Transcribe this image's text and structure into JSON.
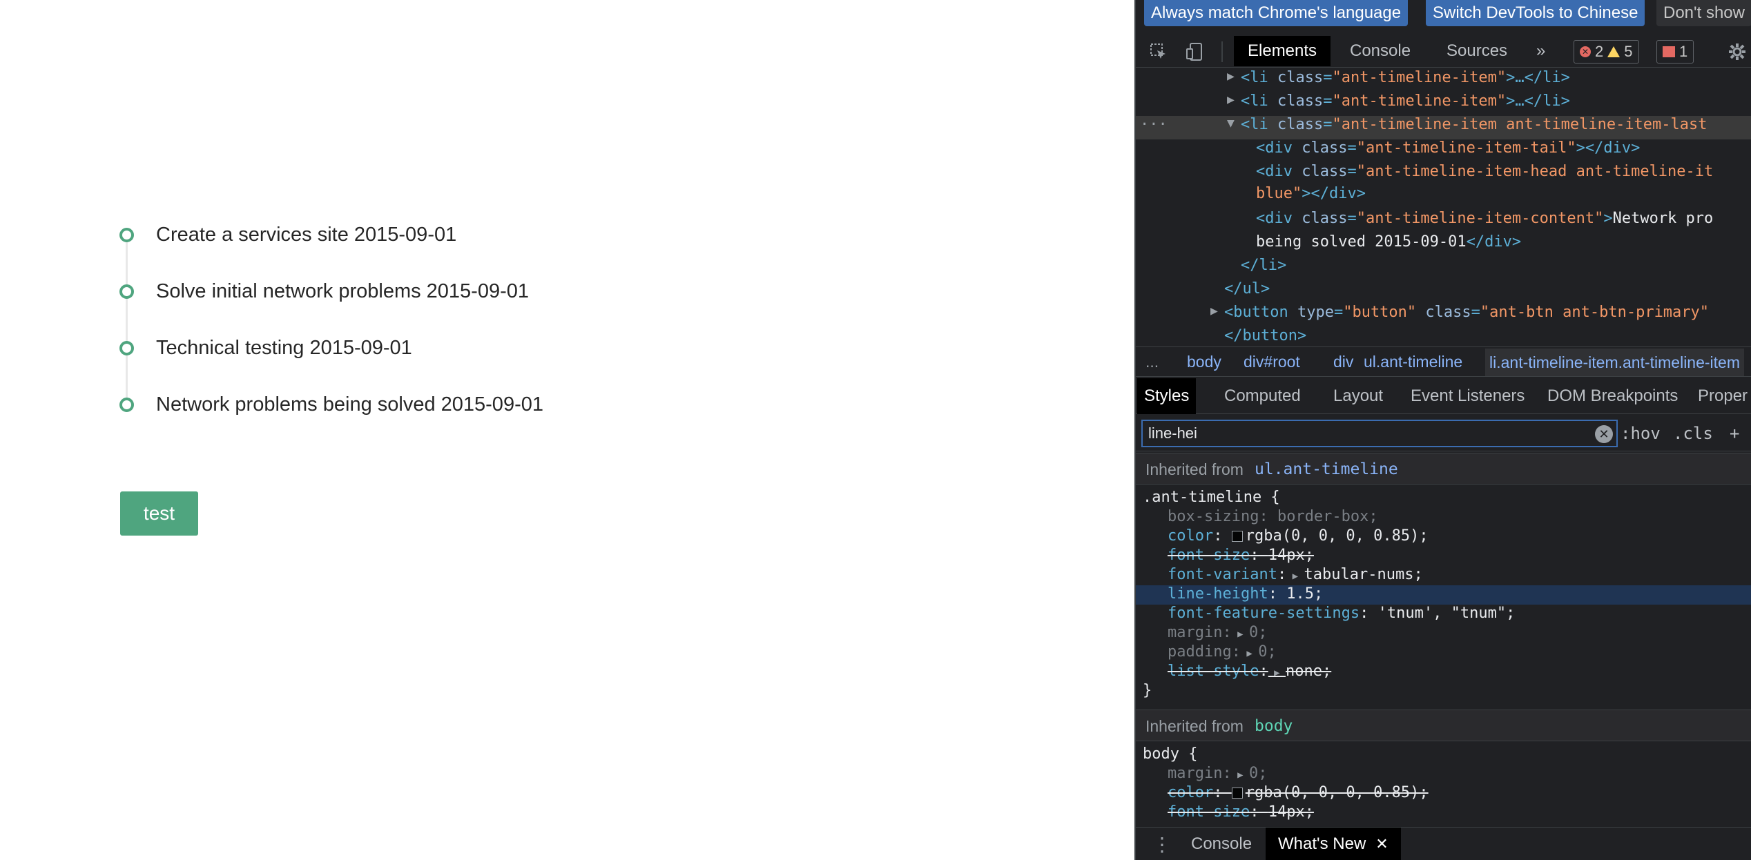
{
  "timeline": {
    "items": [
      {
        "label": "Create a services site 2015-09-01"
      },
      {
        "label": "Solve initial network problems 2015-09-01"
      },
      {
        "label": "Technical testing 2015-09-01"
      },
      {
        "label": "Network problems being solved 2015-09-01"
      }
    ],
    "accent": "#4fa57f"
  },
  "test_button": {
    "label": "test"
  },
  "devtools": {
    "lang_bar": {
      "match": "Always match Chrome's language",
      "switch": "Switch DevTools to Chinese",
      "dont_show": "Don't show"
    },
    "toolbar": {
      "tabs": [
        "Elements",
        "Console",
        "Sources"
      ],
      "more": "»",
      "errors": "2",
      "warnings": "5",
      "issues": "1"
    },
    "dom": {
      "ellipsis": "···",
      "lines": [
        {
          "tag_open": "<li ",
          "attr": "class",
          "eq": "=",
          "val": "\"ant-timeline-item\"",
          "rest": ">…</li>"
        },
        {
          "tag_open": "<li ",
          "attr": "class",
          "eq": "=",
          "val": "\"ant-timeline-item\"",
          "rest": ">…</li>"
        },
        {
          "tag_open": "<li ",
          "attr": "class",
          "eq": "=",
          "val": "\"ant-timeline-item ant-timeline-item-last",
          "rest": ""
        },
        {
          "tag_open": "<div ",
          "attr": "class",
          "eq": "=",
          "val": "\"ant-timeline-item-tail\"",
          "rest": "></div>"
        },
        {
          "tag_open": "<div ",
          "attr": "class",
          "eq": "=",
          "val": "\"ant-timeline-item-head ant-timeline-it",
          "rest": ""
        },
        {
          "tag_open": "",
          "attr": "",
          "eq": "",
          "val": "blue\"",
          "rest": "></div>"
        },
        {
          "tag_open": "<div ",
          "attr": "class",
          "eq": "=",
          "val": "\"ant-timeline-item-content\"",
          "rest": ">",
          "text": "Network pro"
        },
        {
          "tag_open": "",
          "attr": "",
          "eq": "",
          "val": "",
          "rest": "</div>",
          "text": "being solved 2015-09-01"
        },
        {
          "tag_open": "</li>",
          "attr": "",
          "eq": "",
          "val": "",
          "rest": ""
        },
        {
          "tag_open": "</ul>",
          "attr": "",
          "eq": "",
          "val": "",
          "rest": ""
        },
        {
          "tag_open": "<button ",
          "attr": "type",
          "eq": "=",
          "val": "\"button\"",
          "attr2": " class",
          "val2": "\"ant-btn ant-btn-primary\"",
          "rest": ""
        },
        {
          "tag_open": "</button>",
          "attr": "",
          "eq": "",
          "val": "",
          "rest": ""
        }
      ]
    },
    "breadcrumbs": [
      "...",
      "body",
      "div#root",
      "div",
      "ul.ant-timeline",
      "li.ant-timeline-item.ant-timeline-item"
    ],
    "subtabs": [
      "Styles",
      "Computed",
      "Layout",
      "Event Listeners",
      "DOM Breakpoints",
      "Proper"
    ],
    "filter": {
      "value": "line-hei",
      "hov": ":hov",
      "cls": ".cls",
      "plus": "+"
    },
    "styles": {
      "inherited_from_label": "Inherited from",
      "block1_from": "ul.ant-timeline",
      "block1_selector": ".ant-timeline {",
      "block1_props": [
        {
          "name": "box-sizing",
          "value": "border-box;"
        },
        {
          "name": "color",
          "value": "rgba(0, 0, 0, 0.85);"
        },
        {
          "name": "font-size",
          "value": "14px;"
        },
        {
          "name": "font-variant",
          "value": "tabular-nums;"
        },
        {
          "name": "line-height",
          "value": "1.5;"
        },
        {
          "name": "font-feature-settings",
          "value": "'tnum', \"tnum\";"
        },
        {
          "name": "margin",
          "value": "0;"
        },
        {
          "name": "padding",
          "value": "0;"
        },
        {
          "name": "list-style",
          "value": "none;"
        }
      ],
      "close_brace": "}",
      "block2_from": "body",
      "block2_selector": "body {",
      "block2_props": [
        {
          "name": "margin",
          "value": "0;"
        },
        {
          "name": "color",
          "value": "rgba(0, 0, 0, 0.85);"
        },
        {
          "name": "font-size",
          "value": "14px;"
        }
      ]
    },
    "drawer": {
      "console": "Console",
      "whats_new": "What's New",
      "close": "✕"
    }
  }
}
